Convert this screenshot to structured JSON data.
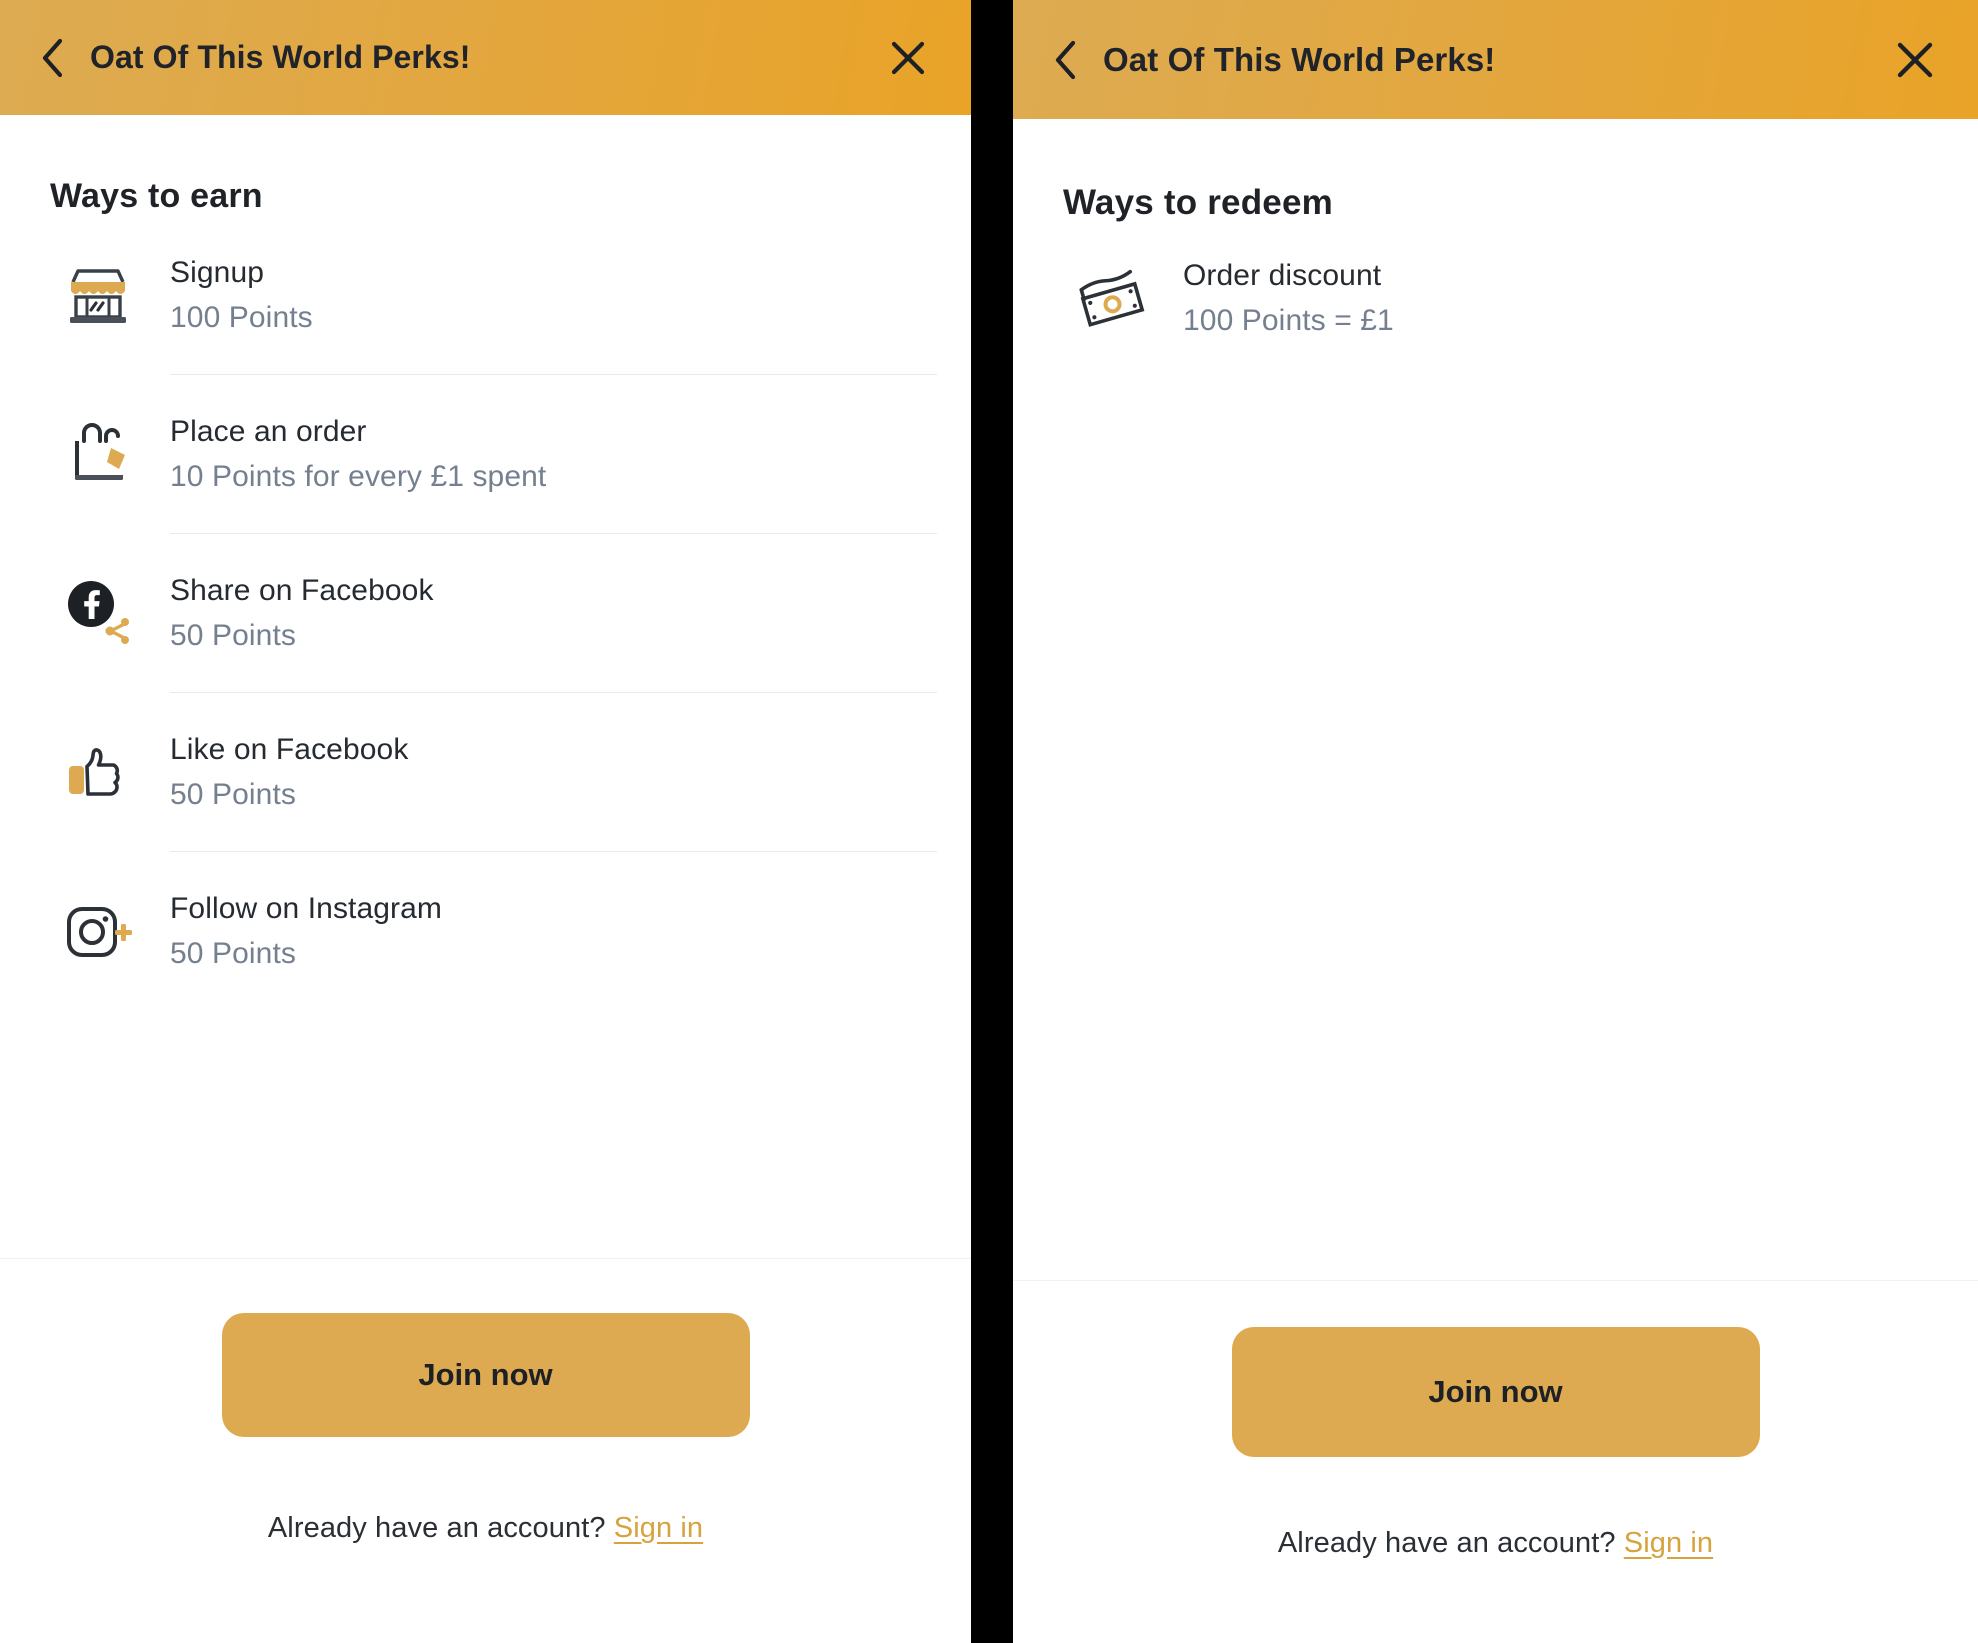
{
  "colors": {
    "header_gradient_start": "#ddab52",
    "header_gradient_end": "#e9a327",
    "accent_gold": "#ddaa51",
    "link_gold": "#d7a33f",
    "title_text": "#262b31",
    "sub_text": "#74808f",
    "divider": "#e7e9ec",
    "panel_gap": "#000000"
  },
  "panels": [
    {
      "id": "ways-to-earn",
      "header": {
        "back_icon": "chevron-left-icon",
        "title": "Oat Of This World Perks!",
        "close_icon": "close-icon"
      },
      "section_title": "Ways to earn",
      "rows": [
        {
          "icon": "market-stall-icon",
          "title": "Signup",
          "sub": "100 Points"
        },
        {
          "icon": "shopping-bag-tag-icon",
          "title": "Place an order",
          "sub": "10 Points for every £1 spent"
        },
        {
          "icon": "facebook-share-icon",
          "title": "Share on Facebook",
          "sub": "50 Points"
        },
        {
          "icon": "thumbs-up-icon",
          "title": "Like on Facebook",
          "sub": "50 Points"
        },
        {
          "icon": "instagram-plus-icon",
          "title": "Follow on Instagram",
          "sub": "50 Points"
        }
      ],
      "footer": {
        "join_label": "Join now",
        "account_prompt": "Already have an account?",
        "signin_label": "Sign in"
      }
    },
    {
      "id": "ways-to-redeem",
      "header": {
        "back_icon": "chevron-left-icon",
        "title": "Oat Of This World Perks!",
        "close_icon": "close-icon"
      },
      "section_title": "Ways to redeem",
      "rows": [
        {
          "icon": "banknotes-icon",
          "title": "Order discount",
          "sub": "100 Points = £1"
        }
      ],
      "footer": {
        "join_label": "Join now",
        "account_prompt": "Already have an account?",
        "signin_label": "Sign in"
      }
    }
  ]
}
